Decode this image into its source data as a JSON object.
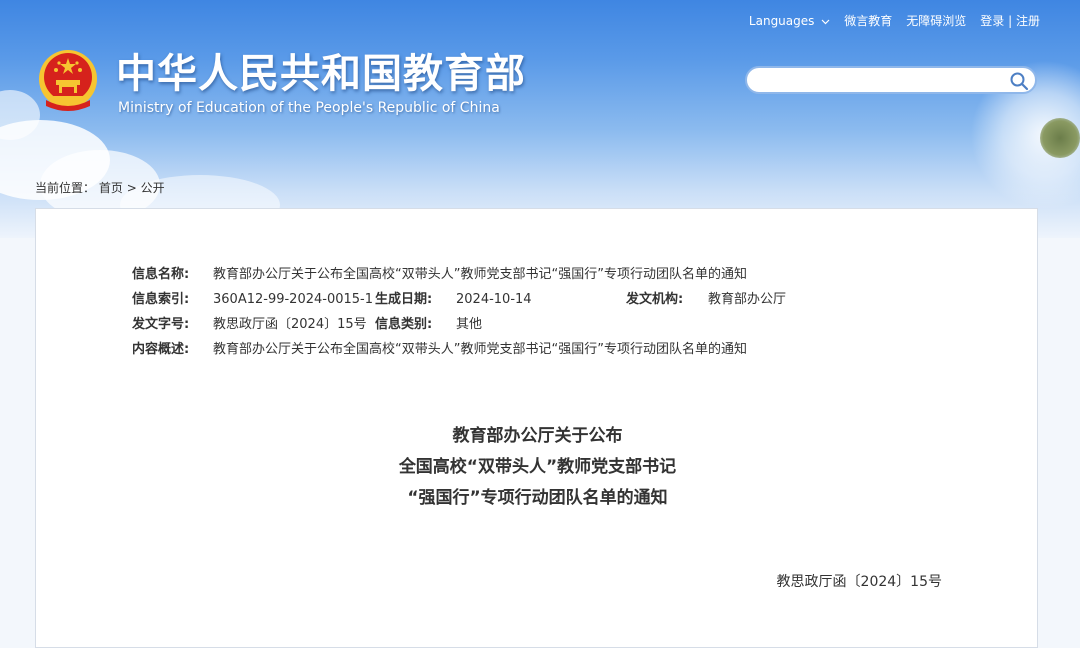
{
  "header": {
    "title": "中华人民共和国教育部",
    "subtitle": "Ministry of Education of the People's Republic of China",
    "links": {
      "languages": "Languages",
      "weibo": "微言教育",
      "accessibility": "无障碍浏览",
      "login": "登录",
      "separator": "|",
      "register": "注册"
    },
    "search": {
      "placeholder": ""
    }
  },
  "breadcrumb": {
    "label": "当前位置：",
    "home": "首页",
    "separator": ">",
    "current": "公开"
  },
  "meta": {
    "info_name_label": "信息名称:",
    "info_name_value": "教育部办公厅关于公布全国高校“双带头人”教师党支部书记“强国行”专项行动团队名单的通知",
    "index_label": "信息索引:",
    "index_value": "360A12-99-2024-0015-1",
    "date_label": "生成日期:",
    "date_value": "2024-10-14",
    "issuer_label": "发文机构:",
    "issuer_value": "教育部办公厅",
    "doc_no_label": "发文字号:",
    "doc_no_value": "教思政厅函〔2024〕15号",
    "category_label": "信息类别:",
    "category_value": "其他",
    "summary_label": "内容概述:",
    "summary_value": "教育部办公厅关于公布全国高校“双带头人”教师党支部书记“强国行”专项行动团队名单的通知"
  },
  "document": {
    "title_line1": "教育部办公厅关于公布",
    "title_line2": "全国高校“双带头人”教师党支部书记",
    "title_line3": "“强国行”专项行动团队名单的通知",
    "number": "教思政厅函〔2024〕15号"
  },
  "colors": {
    "header_top": "#3f86e2",
    "header_bottom": "#eef4fc",
    "emblem_red": "#d6221c",
    "emblem_gold": "#f6c531",
    "search_border": "#8fb7ea"
  },
  "icons": {
    "emblem": "national-emblem-icon",
    "search": "search-icon",
    "chevron": "chevron-down-icon"
  }
}
